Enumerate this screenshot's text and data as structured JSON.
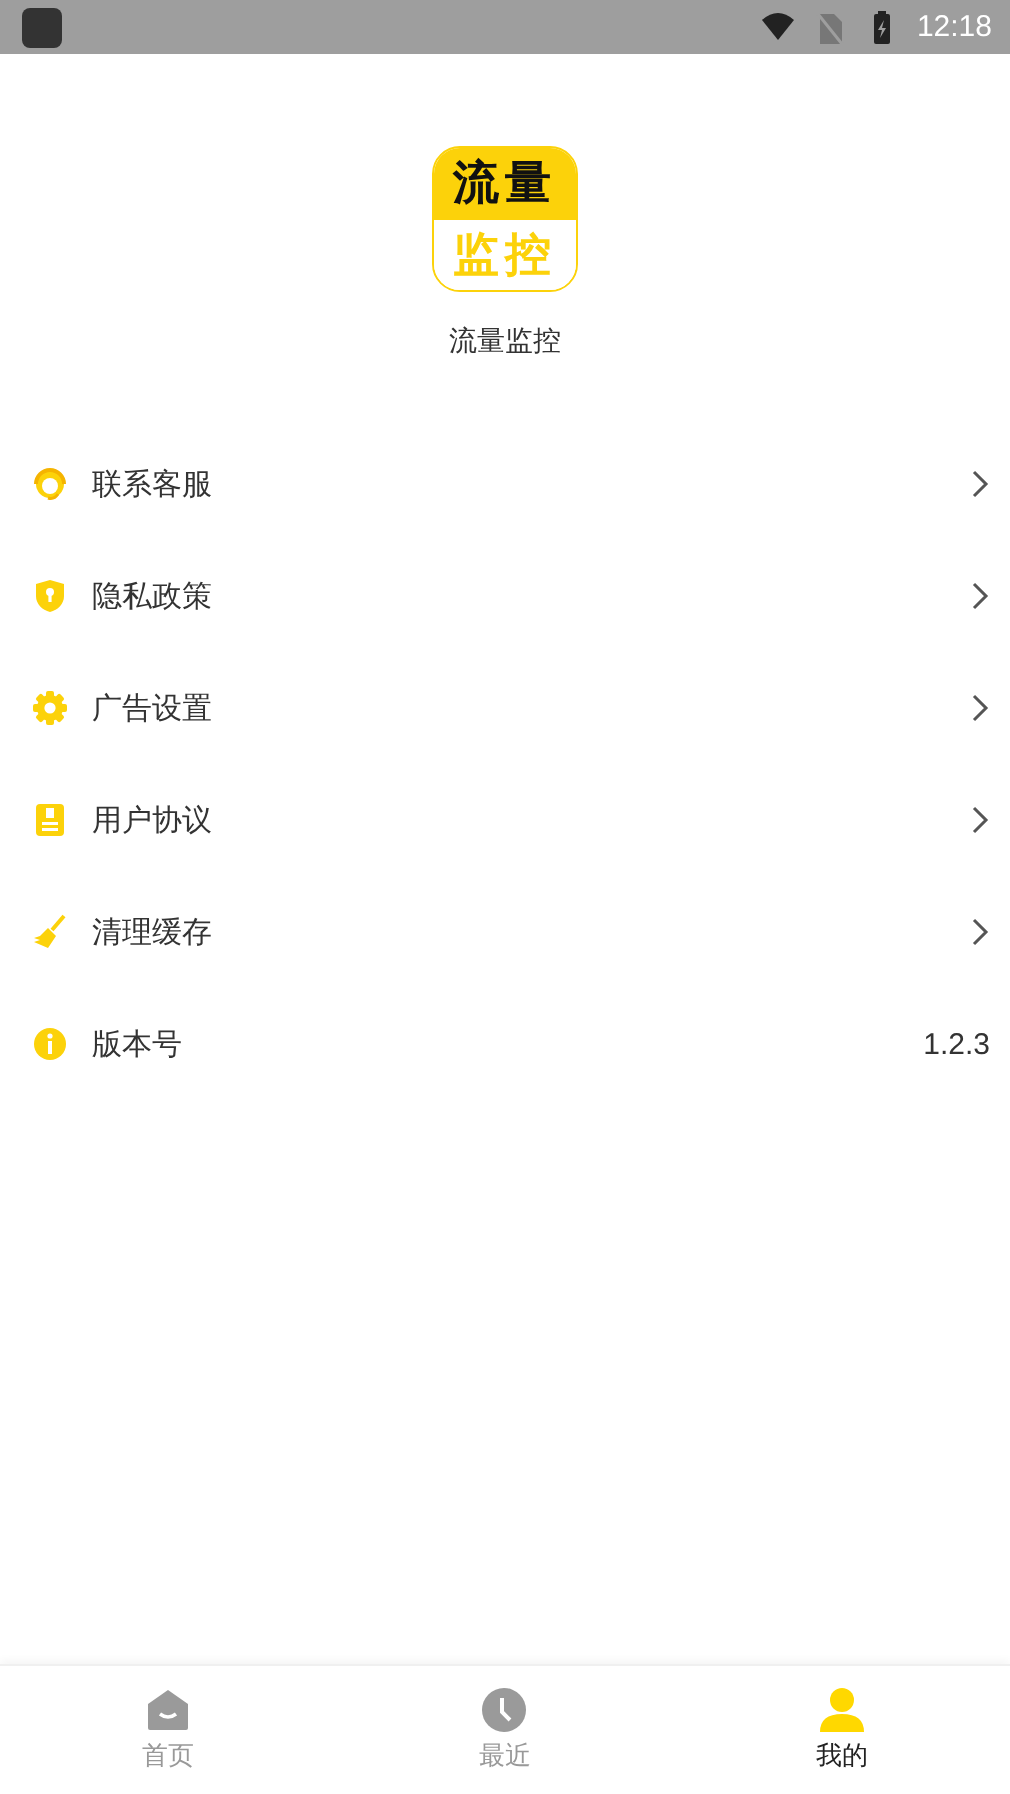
{
  "status_bar": {
    "time": "12:18"
  },
  "app": {
    "logo_lines": [
      "流量",
      "监控"
    ],
    "name": "流量监控"
  },
  "menu": [
    {
      "label": "联系客服",
      "kind": "link"
    },
    {
      "label": "隐私政策",
      "kind": "link"
    },
    {
      "label": "广告设置",
      "kind": "link"
    },
    {
      "label": "用户协议",
      "kind": "link"
    },
    {
      "label": "清理缓存",
      "kind": "link"
    },
    {
      "label": "版本号",
      "kind": "value",
      "value": "1.2.3"
    }
  ],
  "tabs": [
    {
      "label": "首页",
      "selected": false
    },
    {
      "label": "最近",
      "selected": false
    },
    {
      "label": "我的",
      "selected": true
    }
  ]
}
